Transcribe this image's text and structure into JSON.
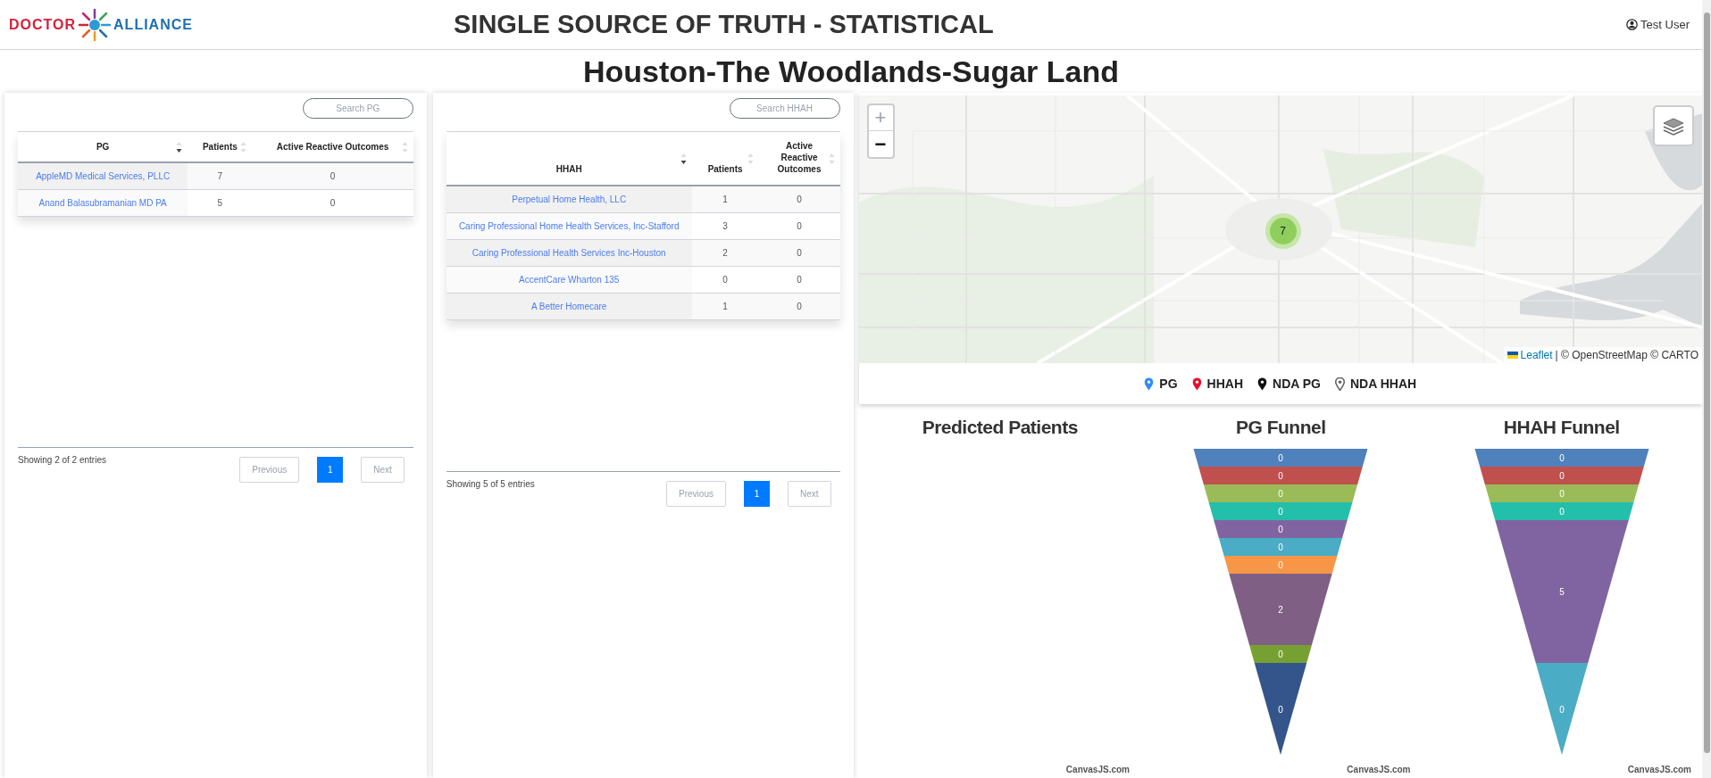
{
  "header": {
    "logo": [
      "DOCTOR",
      "ALLIANCE"
    ],
    "title": "SINGLE SOURCE OF TRUTH - STATISTICAL",
    "user": "Test User"
  },
  "region_title": "Houston-The Woodlands-Sugar Land",
  "tables": [
    {
      "search": {
        "placeholder": "Search PG"
      },
      "columns": [
        {
          "label": "PG",
          "sorted": true
        },
        {
          "label": "Patients",
          "sorted": false
        },
        {
          "label": "Active Reactive Outcomes",
          "sorted": false
        }
      ],
      "rows": [
        [
          "AppleMD Medical Services, PLLC",
          "7",
          "0"
        ],
        [
          "Anand Balasubramanian MD PA",
          "5",
          "0"
        ]
      ],
      "info": "Showing 2 of 2 entries",
      "pagination": [
        {
          "label": "Previous",
          "kind": "nav",
          "disabled": true,
          "selected": false
        },
        {
          "label": "1",
          "kind": "page",
          "disabled": false,
          "selected": true
        },
        {
          "label": "Next",
          "kind": "nav",
          "disabled": true,
          "selected": false
        }
      ]
    },
    {
      "search": {
        "placeholder": "Search HHAH"
      },
      "columns": [
        {
          "label": "HHAH",
          "sorted": true
        },
        {
          "label": "Patients",
          "sorted": false
        },
        {
          "label": "Active Reactive Outcomes",
          "sorted": false
        }
      ],
      "rows": [
        [
          "Perpetual Home Health, LLC",
          "1",
          "0"
        ],
        [
          "Caring Professional Home Health Services, Inc-Stafford",
          "3",
          "0"
        ],
        [
          "Caring Professional Health Services Inc-Houston",
          "2",
          "0"
        ],
        [
          "AccentCare Wharton 135",
          "0",
          "0"
        ],
        [
          "A Better Homecare",
          "1",
          "0"
        ]
      ],
      "info": "Showing 5 of 5 entries",
      "pagination": [
        {
          "label": "Previous",
          "kind": "nav",
          "disabled": true,
          "selected": false
        },
        {
          "label": "1",
          "kind": "page",
          "disabled": false,
          "selected": true
        },
        {
          "label": "Next",
          "kind": "nav",
          "disabled": true,
          "selected": false
        }
      ]
    }
  ],
  "map": {
    "zoom_in": "+",
    "zoom_out": "−",
    "cluster": "7",
    "attribution": {
      "link": "Leaflet",
      "text": "| © OpenStreetMap © CARTO"
    },
    "legend": [
      {
        "label": "PG",
        "kind": "filled",
        "color": "#2f8ef5"
      },
      {
        "label": "HHAH",
        "kind": "filled",
        "color": "#e8102e"
      },
      {
        "label": "NDA PG",
        "kind": "filled",
        "color": "#111111"
      },
      {
        "label": "NDA HHAH",
        "kind": "outline",
        "color": "#666666"
      }
    ]
  },
  "charts": [
    {
      "title": "Predicted Patients",
      "credit": "CanvasJS.com"
    },
    {
      "title": "PG Funnel",
      "credit": "CanvasJS.com",
      "segments": [
        {
          "value": "0",
          "color": "#4f81bc"
        },
        {
          "value": "0",
          "color": "#c0504e"
        },
        {
          "value": "0",
          "color": "#9bbb58"
        },
        {
          "value": "0",
          "color": "#23bfaa"
        },
        {
          "value": "0",
          "color": "#8064a1"
        },
        {
          "value": "0",
          "color": "#4aacc5"
        },
        {
          "value": "0",
          "color": "#f79647"
        },
        {
          "value": "2",
          "color": "#7f6084"
        },
        {
          "value": "0",
          "color": "#77a033"
        },
        {
          "value": "0",
          "color": "#33558b"
        }
      ]
    },
    {
      "title": "HHAH Funnel",
      "credit": "CanvasJS.com",
      "segments": [
        {
          "value": "0",
          "color": "#4f81bc"
        },
        {
          "value": "0",
          "color": "#c0504e"
        },
        {
          "value": "0",
          "color": "#9bbb58"
        },
        {
          "value": "0",
          "color": "#23bfaa"
        },
        {
          "value": "5",
          "color": "#8064a1"
        },
        {
          "value": "0",
          "color": "#4aacc5"
        }
      ]
    }
  ]
}
